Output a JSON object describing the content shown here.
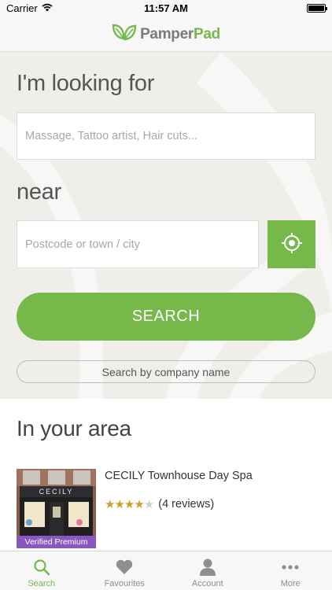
{
  "status_bar": {
    "carrier": "Carrier",
    "time": "11:57 AM",
    "battery_level": 1.0
  },
  "header": {
    "logo_part1": "Pamper",
    "logo_part2": "Pad",
    "logo_icon": "leaf-icon"
  },
  "search": {
    "looking_for_label": "I'm looking for",
    "service_placeholder": "Massage, Tattoo artist, Hair cuts...",
    "service_value": "",
    "near_label": "near",
    "location_placeholder": "Postcode or town / city",
    "location_value": "",
    "locate_icon": "crosshair-icon",
    "search_button_label": "SEARCH",
    "company_button_label": "Search by company name"
  },
  "area": {
    "title": "In your area",
    "listings": [
      {
        "name": "CECILY Townhouse Day Spa",
        "rating": 4,
        "rating_max": 5,
        "reviews": "(4 reviews)",
        "badge": "Verified Premium",
        "sign_text": "CECILY"
      }
    ]
  },
  "tabs": [
    {
      "label": "Search",
      "icon": "search-icon",
      "active": true
    },
    {
      "label": "Favourites",
      "icon": "heart-icon",
      "active": false
    },
    {
      "label": "Account",
      "icon": "user-icon",
      "active": false
    },
    {
      "label": "More",
      "icon": "ellipsis-icon",
      "active": false
    }
  ],
  "colors": {
    "brand_green": "#76b84a",
    "panel_bg": "#efeeea",
    "badge_purple": "#8a56c0",
    "star_gold": "#c9a227"
  }
}
